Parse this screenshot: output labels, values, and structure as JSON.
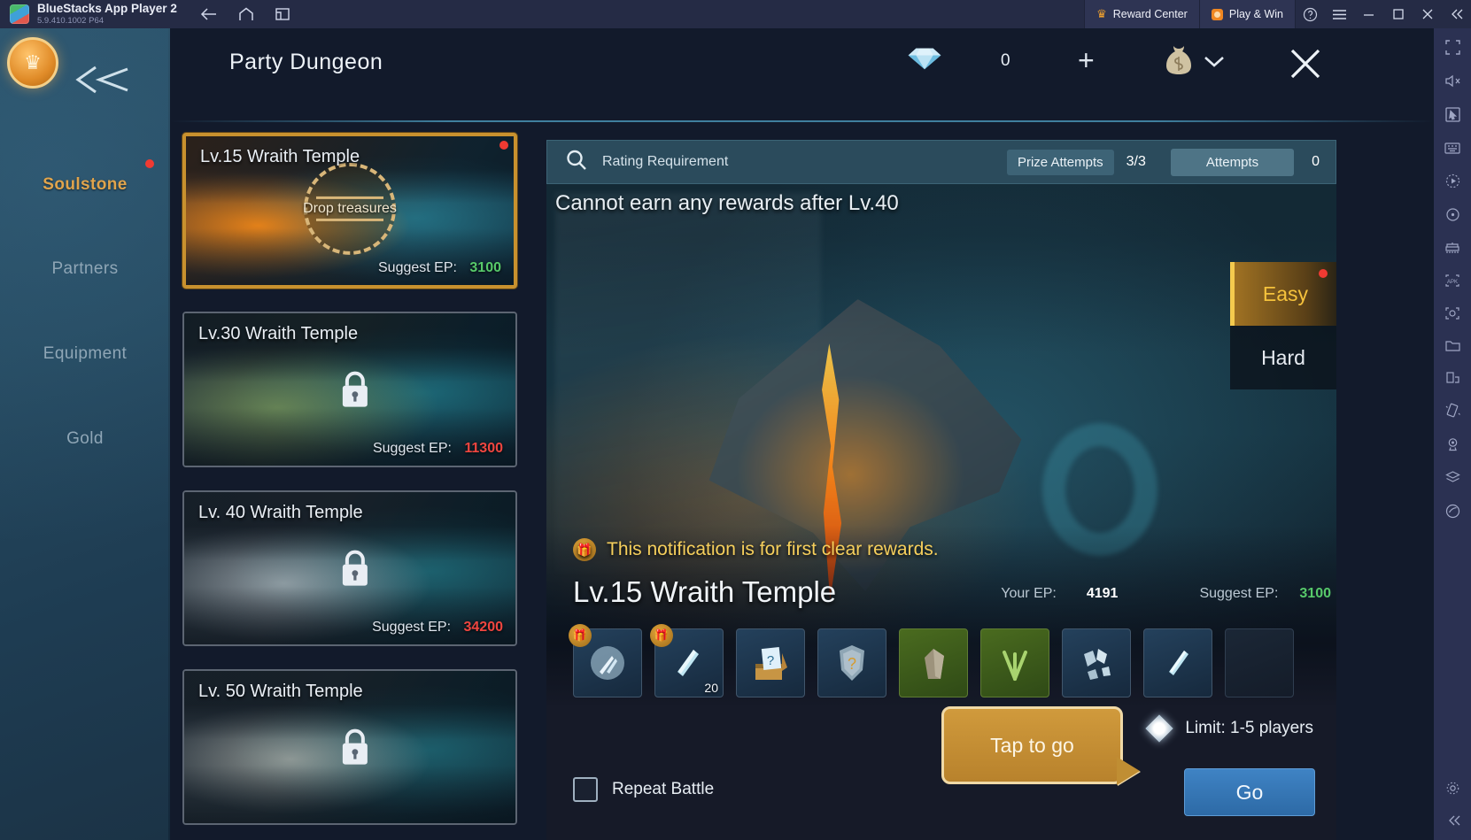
{
  "emulator": {
    "app_title": "BlueStacks App Player 2",
    "app_version": "5.9.410.1002  P64",
    "nav": {
      "back": "back-arrow",
      "home": "home",
      "multi_instance": "multi-instance"
    },
    "reward_center": "Reward Center",
    "play_and_win": "Play & Win",
    "window_controls": [
      "help",
      "menu",
      "minimize",
      "maximize",
      "close",
      "collapse"
    ],
    "sidebar_icons": [
      "fullscreen",
      "mute",
      "pointer",
      "keyboard-controls",
      "macro-play",
      "rotate",
      "multi-instance-manager",
      "install-apk",
      "screenshot",
      "media-manager",
      "shake",
      "location",
      "layers",
      "eco-mode",
      "settings",
      "collapse-arrow"
    ]
  },
  "game": {
    "left_nav": {
      "emblem": "crown-emblem",
      "items": [
        {
          "label": "Soulstone",
          "active": true,
          "badge": true
        },
        {
          "label": "Partners",
          "active": false,
          "badge": false
        },
        {
          "label": "Equipment",
          "active": false,
          "badge": false
        },
        {
          "label": "Gold",
          "active": false,
          "badge": false
        }
      ]
    },
    "header": {
      "title": "Party Dungeon",
      "currency_icon": "diamond-icon",
      "currency_value": "0",
      "add_label": "+",
      "wallet_icon": "money-bag-icon",
      "wallet_chevron": "chevron-down-icon",
      "close_label": "close-icon"
    },
    "dungeon_list": [
      {
        "name": "Lv.15 Wraith Temple",
        "ep_label": "Suggest EP:",
        "ep_value": "3100",
        "ep_color": "#57c96a",
        "selected": true,
        "locked": false,
        "badge": true,
        "seal_text": "Drop treasures"
      },
      {
        "name": "Lv.30 Wraith Temple",
        "ep_label": "Suggest EP:",
        "ep_value": "11300",
        "ep_color": "#ef4640",
        "selected": false,
        "locked": true,
        "badge": false,
        "seal_text": ""
      },
      {
        "name": "Lv. 40 Wraith Temple",
        "ep_label": "Suggest EP:",
        "ep_value": "34200",
        "ep_color": "#ef4640",
        "selected": false,
        "locked": true,
        "badge": false,
        "seal_text": ""
      },
      {
        "name": "Lv. 50 Wraith Temple",
        "ep_label": "",
        "ep_value": "",
        "ep_color": "#ef4640",
        "selected": false,
        "locked": true,
        "badge": false,
        "seal_text": ""
      }
    ],
    "top_bar": {
      "search_icon": "search-icon",
      "rating_requirement": "Rating Requirement",
      "prize_attempts_label": "Prize Attempts",
      "prize_attempts_value": "3/3",
      "attempts_label": "Attempts",
      "attempts_value": "0"
    },
    "stage": {
      "warning": "Cannot earn any rewards after Lv.40",
      "difficulty": [
        {
          "label": "Easy",
          "selected": true,
          "badge": true
        },
        {
          "label": "Hard",
          "selected": false,
          "badge": false
        }
      ],
      "notification": "This notification is for first clear rewards.",
      "notification_icon": "gift-icon",
      "dungeon_name": "Lv.15 Wraith Temple",
      "your_ep_label": "Your EP:",
      "your_ep_value": "4191",
      "suggest_ep_label": "Suggest EP:",
      "suggest_ep_value": "3100",
      "rewards": [
        {
          "icon": "orb-shard-icon",
          "first_clear": true,
          "count": "",
          "tone": "blue"
        },
        {
          "icon": "crystal-blade-icon",
          "first_clear": true,
          "count": "20",
          "tone": "blue"
        },
        {
          "icon": "mystery-chest-icon",
          "first_clear": false,
          "count": "",
          "tone": "blue"
        },
        {
          "icon": "unknown-shield-icon",
          "first_clear": false,
          "count": "",
          "tone": "blue"
        },
        {
          "icon": "stone-icon",
          "first_clear": false,
          "count": "",
          "tone": "green"
        },
        {
          "icon": "herb-icon",
          "first_clear": false,
          "count": "",
          "tone": "green"
        },
        {
          "icon": "ore-fragments-icon",
          "first_clear": false,
          "count": "",
          "tone": "blue"
        },
        {
          "icon": "crystal-sliver-icon",
          "first_clear": false,
          "count": "",
          "tone": "blue"
        },
        {
          "icon": "empty-slot",
          "first_clear": false,
          "count": "",
          "tone": "empty"
        }
      ],
      "tooltip": "Tap to go",
      "limit_icon": "diamond-marker-icon",
      "limit_text": "Limit: 1-5 players",
      "repeat_battle_label": "Repeat Battle",
      "repeat_battle_checked": false,
      "go_label": "Go"
    }
  },
  "colors": {
    "accent_gold": "#e0a44c",
    "select_border": "#c8912e",
    "ep_green": "#57c96a",
    "ep_red": "#ef4640",
    "badge_red": "#f03a32",
    "go_blue": "#3f83c4",
    "panel_teal": "#2b4b5c"
  }
}
